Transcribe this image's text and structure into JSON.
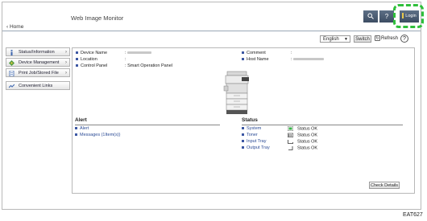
{
  "header": {
    "app_title": "Web Image Monitor",
    "home_link": "Home",
    "search_icon": "search-icon",
    "help_icon": "?",
    "login_label": "Login",
    "highlight_color": "#2fbf3b"
  },
  "toolbar": {
    "language_value": "English",
    "switch_label": "Switch",
    "refresh_label": "Refresh",
    "help_label": "?"
  },
  "sidebar": {
    "items": [
      {
        "label": "Status/Information",
        "icon": "status-icon"
      },
      {
        "label": "Device Management",
        "icon": "device-management-icon"
      },
      {
        "label": "Print Job/Stored File",
        "icon": "print-job-icon"
      },
      {
        "label": "Convenient Links",
        "icon": "links-icon"
      }
    ]
  },
  "device_info": {
    "device_name_label": "Device Name",
    "location_label": "Location",
    "control_panel_label": "Control Panel",
    "control_panel_value": "Smart Operation Panel",
    "comment_label": "Comment",
    "host_name_label": "Host Name",
    "separator": ":"
  },
  "alert": {
    "title": "Alert",
    "items": [
      "Alert",
      "Messages (1Item(s))"
    ]
  },
  "status": {
    "title": "Status",
    "items": [
      {
        "label": "System",
        "value": "Status OK",
        "icon": "system-ok-icon"
      },
      {
        "label": "Toner",
        "value": "Status OK",
        "icon": "toner-icon"
      },
      {
        "label": "Input Tray",
        "value": "Status OK",
        "icon": "input-tray-icon"
      },
      {
        "label": "Output Tray",
        "value": "Status OK",
        "icon": "output-tray-icon"
      }
    ],
    "check_details_label": "Check Details"
  },
  "footer_code": "EAT627"
}
